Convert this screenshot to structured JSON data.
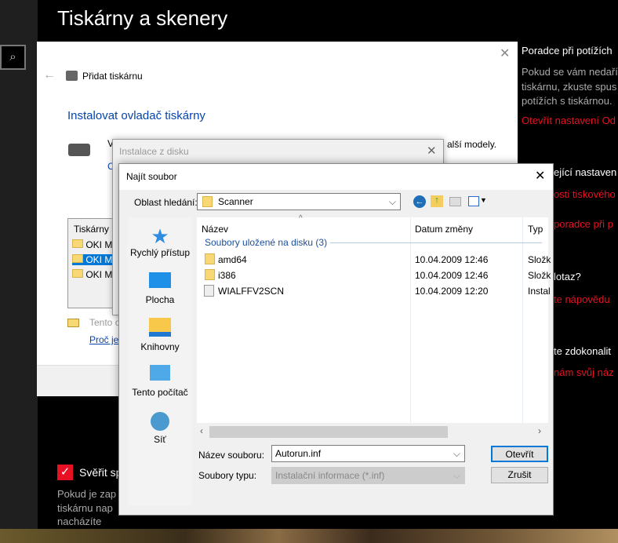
{
  "page": {
    "title": "Tiskárny a skenery"
  },
  "add_printer": {
    "title": "Přidat tiskárnu",
    "heading": "Instalovat ovladač tiskárny",
    "partial_text": "V",
    "partial_text2": "C",
    "models_text": "alší modely.",
    "list_header": "Tiskárny",
    "printers": [
      "OKI M",
      "OKI M",
      "OKI M"
    ],
    "tento": "Tento o",
    "proc": "Proč je"
  },
  "right_panel": {
    "troubleshoot_title": "Poradce při potížích",
    "troubleshoot_text": [
      "Pokud se vám nedaří",
      "tiskárnu, zkuste spus",
      "potížích s tiskárnou."
    ],
    "open_settings": "Otevřít nastavení Od",
    "related_title": "ející nastaven",
    "link1": "osti tiskového",
    "link2": "poradce při p",
    "question": "lotaz?",
    "help": "te nápovědu",
    "improve": "te zdokonalit",
    "feedback": "nám svůj náz"
  },
  "bottom": {
    "checkbox_label": "Svěřit sp",
    "text": [
      "Pokud je zap",
      "tiskárnu nap",
      "nacházíte"
    ]
  },
  "install_disk": {
    "title": "Instalace z disku"
  },
  "find_file": {
    "title": "Najít soubor",
    "look_in_label": "Oblast hledání:",
    "look_in": "Scanner",
    "places": [
      "Rychlý přístup",
      "Plocha",
      "Knihovny",
      "Tento počítač",
      "Síť"
    ],
    "columns": [
      "Název",
      "Datum změny",
      "Typ"
    ],
    "group": "Soubory uložené na disku (3)",
    "files": [
      {
        "name": "amd64",
        "date": "10.04.2009 12:46",
        "type": "Složk"
      },
      {
        "name": "i386",
        "date": "10.04.2009 12:46",
        "type": "Složk"
      },
      {
        "name": "WIALFFV2SCN",
        "date": "10.04.2009 12:20",
        "type": "Instal"
      }
    ],
    "filename_label": "Název souboru:",
    "filename": "Autorun.inf",
    "filetype_label": "Soubory typu:",
    "filetype": "Instalační informace (*.inf)",
    "open": "Otevřít",
    "cancel": "Zrušit"
  },
  "colors": {
    "accent": "#0078d7",
    "red": "#e81123"
  }
}
